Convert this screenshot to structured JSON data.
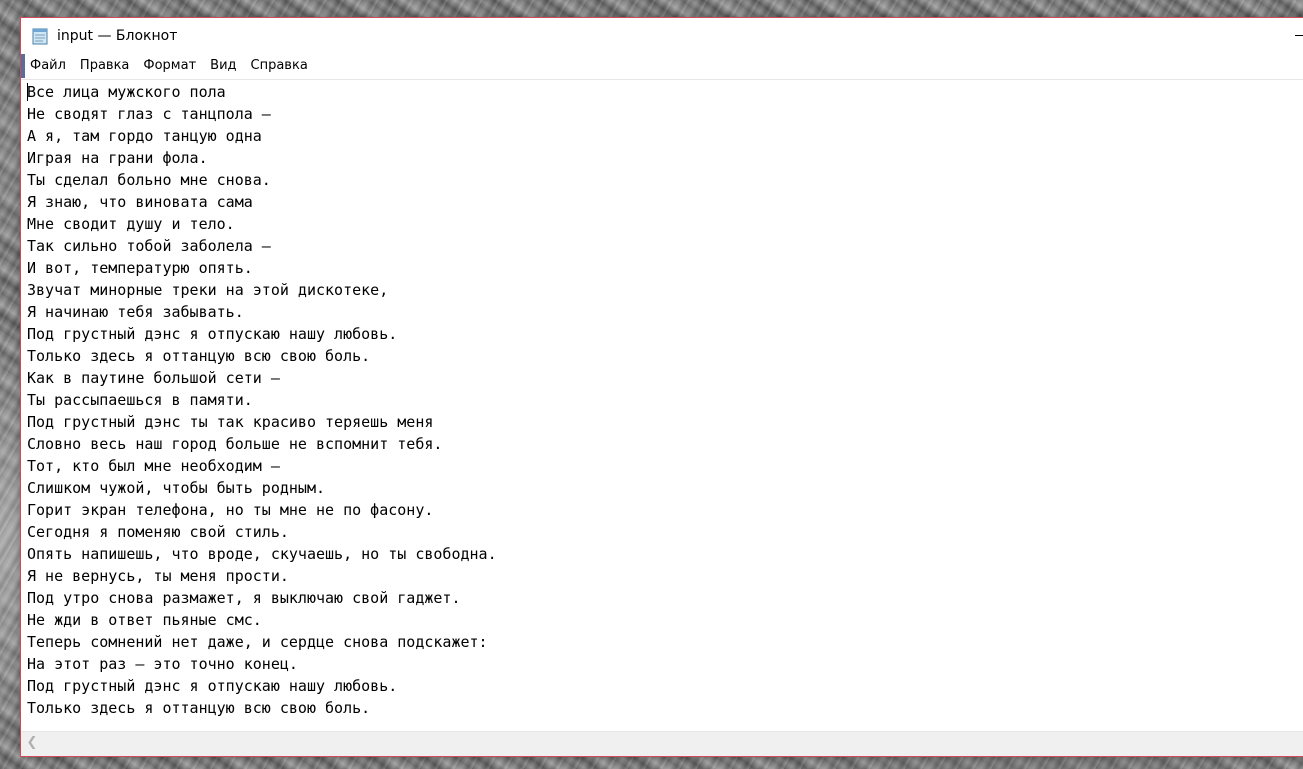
{
  "window": {
    "title": "input — Блокнот",
    "accent_border": "#d14a5a"
  },
  "icons": {
    "app": "notepad-icon",
    "minimize": "minimize-icon",
    "scroll_left": "chevron-left-icon"
  },
  "menu": {
    "items": [
      "Файл",
      "Правка",
      "Формат",
      "Вид",
      "Справка"
    ]
  },
  "editor": {
    "lines": [
      "Все лица мужского пола",
      "Не сводят глаз с танцпола –",
      "А я, там гордо танцую одна",
      "Играя на грани фола.",
      "Ты сделал больно мне снова.",
      "Я знаю, что виновата сама",
      "Мне сводит душу и тело.",
      "Так сильно тобой заболела –",
      "И вот, температурю опять.",
      "Звучат минорные треки на этой дискотеке,",
      "Я начинаю тебя забывать.",
      "Под грустный дэнс я отпускаю нашу любовь.",
      "Только здесь я оттанцую всю свою боль.",
      "Как в паутине большой сети –",
      "Ты рассыпаешься в памяти.",
      "Под грустный дэнс ты так красиво теряешь меня",
      "Словно весь наш город больше не вспомнит тебя.",
      "Тот, кто был мне необходим –",
      "Слишком чужой, чтобы быть родным.",
      "Горит экран телефона, но ты мне не по фасону.",
      "Сегодня я поменяю свой стиль.",
      "Опять напишешь, что вроде, скучаешь, но ты свободна.",
      "Я не вернусь, ты меня прости.",
      "Под утро снова размажет, я выключаю свой гаджет.",
      "Не жди в ответ пьяные смс.",
      "Теперь сомнений нет даже, и сердце снова подскажет:",
      "На этот раз – это точно конец.",
      "Под грустный дэнс я отпускаю нашу любовь.",
      "Только здесь я оттанцую всю свою боль."
    ]
  }
}
